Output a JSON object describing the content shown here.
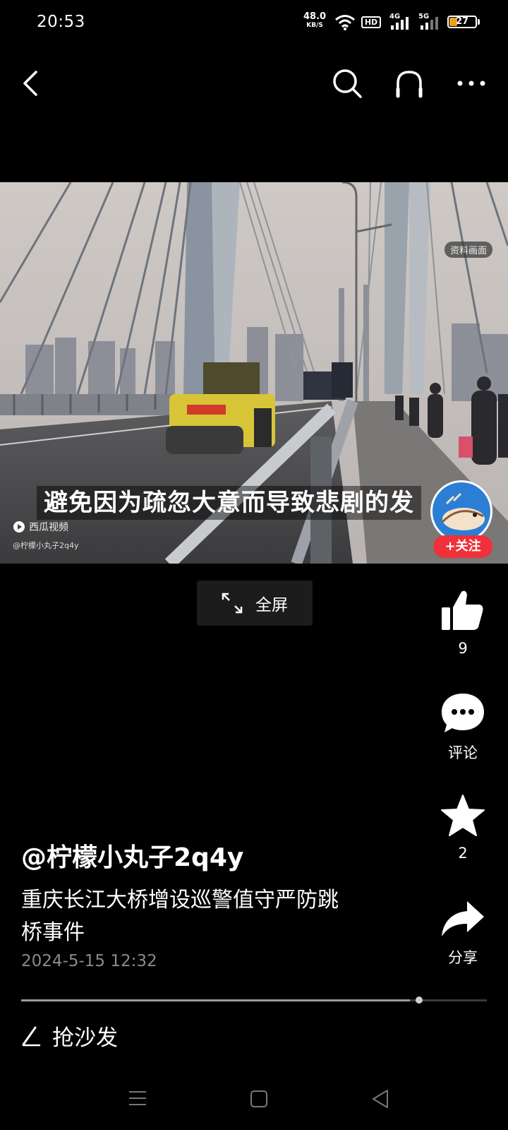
{
  "status_bar": {
    "time": "20:53",
    "net_speed": "48.0",
    "net_unit": "KB/S",
    "network_1": "4G",
    "network_2": "5G",
    "hd_badge": "HD",
    "battery": "27"
  },
  "top_bar": {
    "back_icon": "chevron-left",
    "search_icon": "search",
    "listen_icon": "headphones",
    "more_icon": "more-horizontal"
  },
  "video": {
    "subtitle": "避免因为疏忽大意而导致悲剧的发",
    "tag": "资料画面",
    "watermark_brand": "西瓜视频",
    "watermark_user": "@柠檬小丸子2q4y",
    "follow_label": "+关注",
    "progress_fraction": 0.835
  },
  "fullscreen": {
    "label": "全屏"
  },
  "actions": {
    "like_count": "9",
    "comment_label": "评论",
    "favorite_count": "2",
    "share_label": "分享"
  },
  "post": {
    "author": "@柠檬小丸子2q4y",
    "description_line1": "重庆长江大桥增设巡警值守严防跳",
    "description_line2": "桥事件",
    "date": "2024-5-15 12:32"
  },
  "comment": {
    "placeholder": "抢沙发"
  },
  "colors": {
    "background": "#000000",
    "follow_red": "#f0303a",
    "battery_fill": "#e8a020"
  }
}
